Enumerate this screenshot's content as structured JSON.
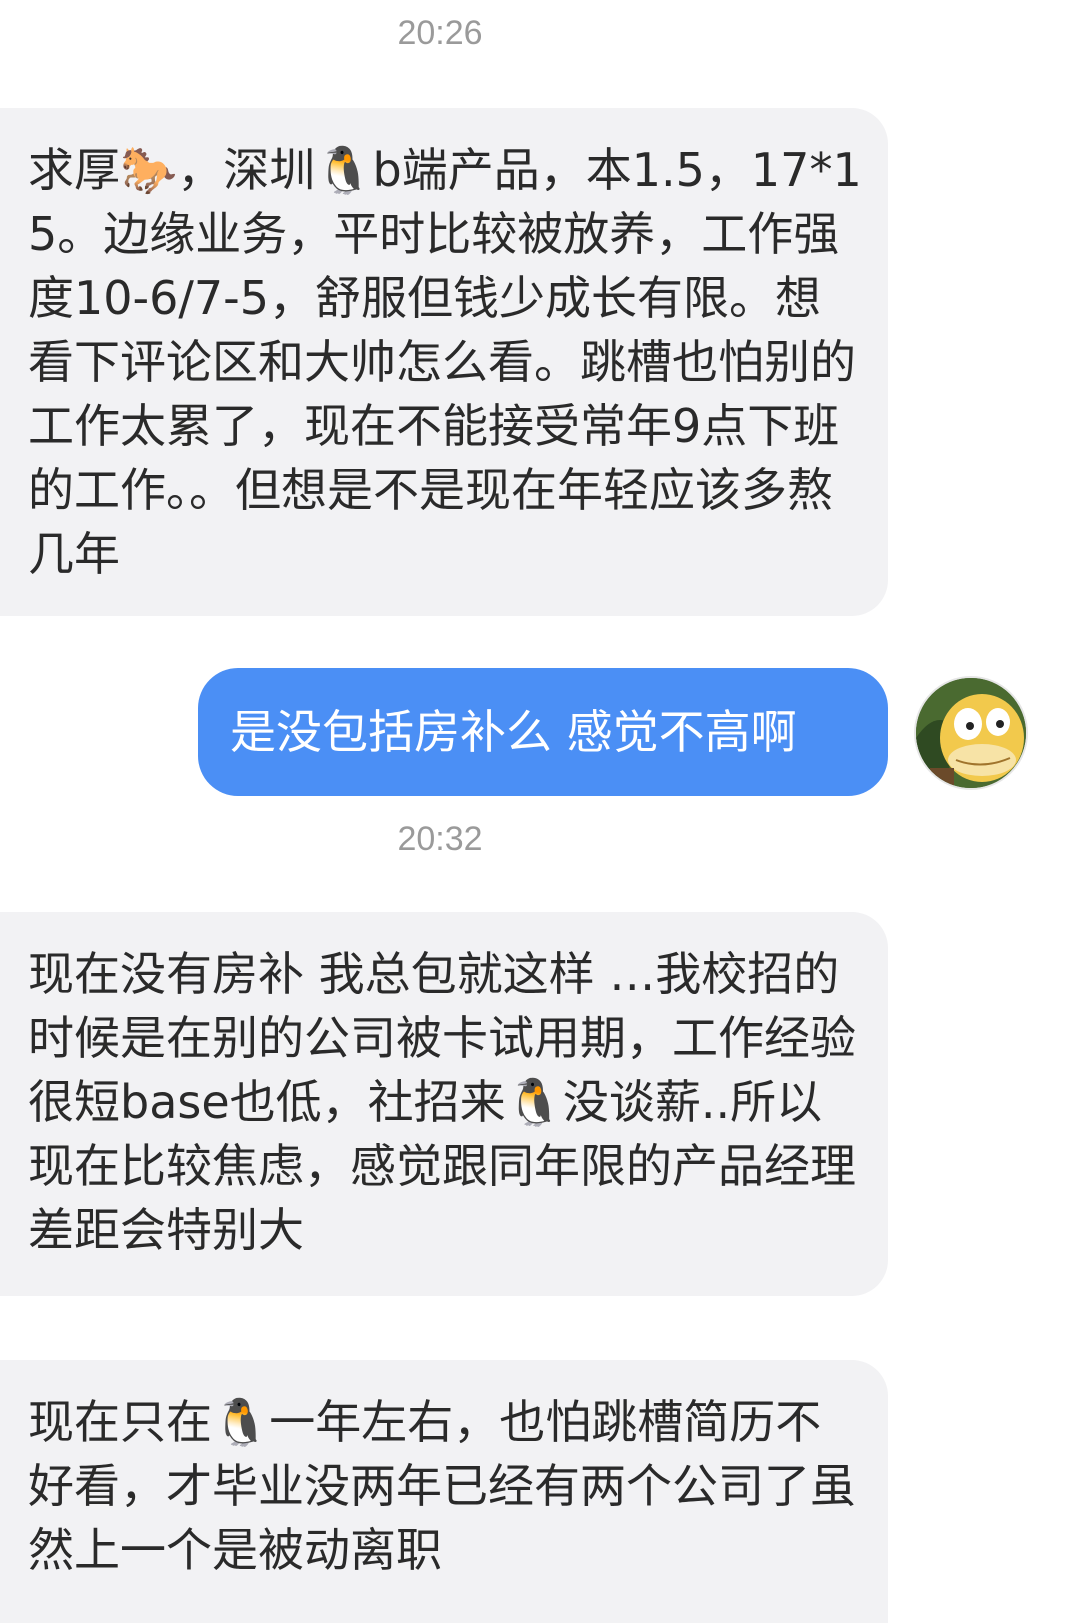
{
  "messages": [
    {
      "type": "timestamp",
      "text": "20:26"
    },
    {
      "type": "received",
      "text": "求厚🐎，深圳🐧b端产品，本1.5，17*15。边缘业务，平时比较被放养，工作强度10-6/7-5，舒服但钱少成长有限。想看下评论区和大帅怎么看。跳槽也怕别的工作太累了，现在不能接受常年9点下班的工作。。但想是不是现在年轻应该多熬几年"
    },
    {
      "type": "sent",
      "text": "是没包括房补么 感觉不高啊"
    },
    {
      "type": "timestamp",
      "text": "20:32"
    },
    {
      "type": "received",
      "text": "现在没有房补 我总包就这样 …我校招的时候是在别的公司被卡试用期，工作经验很短base也低，社招来🐧没谈薪..所以现在比较焦虑，感觉跟同年限的产品经理差距会特别大"
    },
    {
      "type": "received",
      "text": "现在只在🐧一年左右，也怕跳槽简历不好看，才毕业没两年已经有两个公司了虽然上一个是被动离职"
    }
  ],
  "avatar": {
    "icon": "psyduck-avatar-icon"
  },
  "colors": {
    "sent_bubble": "#4b8ff5",
    "received_bubble": "#f2f2f4",
    "timestamp": "#9a9a9a"
  }
}
